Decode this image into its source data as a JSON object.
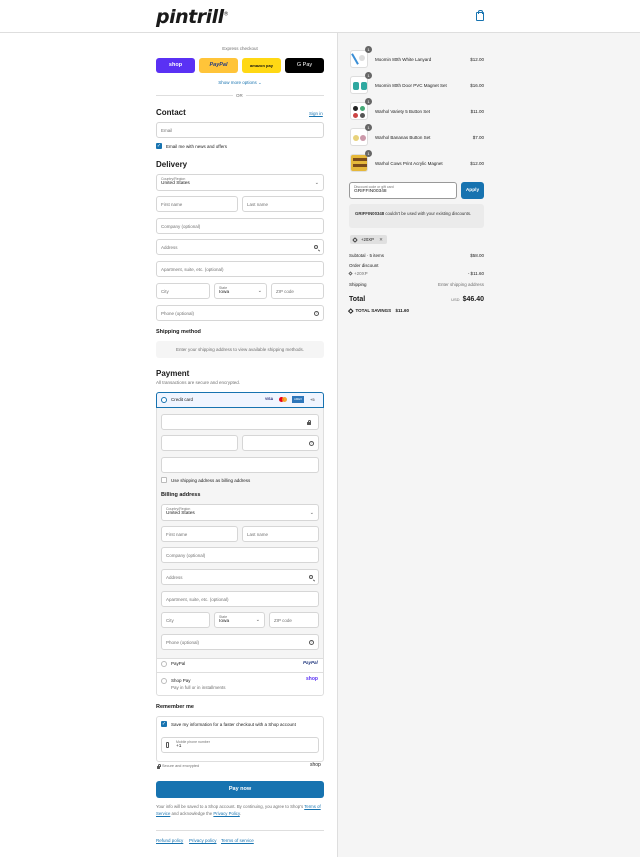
{
  "brand": {
    "logo_text": "pintrill",
    "logo_mark": "®"
  },
  "express": {
    "label": "Express checkout",
    "shop": "shop",
    "paypal": "PayPal",
    "amazon": "amazon pay",
    "gpay": "G Pay",
    "show_more": "Show more options ⌄",
    "or": "OR"
  },
  "contact": {
    "title": "Contact",
    "sign_in": "Sign in",
    "email_placeholder": "Email",
    "news_label": "Email me with news and offers"
  },
  "delivery": {
    "title": "Delivery",
    "country_label": "Country/Region",
    "country_value": "United States",
    "first_name": "First name",
    "last_name": "Last name",
    "company": "Company (optional)",
    "address": "Address",
    "apartment": "Apartment, suite, etc. (optional)",
    "city": "City",
    "state_label": "State",
    "state_value": "Iowa",
    "zip": "ZIP code",
    "phone": "Phone (optional)"
  },
  "shipping": {
    "title": "Shipping method",
    "notice": "Enter your shipping address to view available shipping methods."
  },
  "payment": {
    "title": "Payment",
    "subtitle": "All transactions are secure and encrypted.",
    "credit_card": "Credit card",
    "card_brands": [
      "VISA",
      "MC",
      "AMEX",
      "+5"
    ],
    "use_shipping": "Use shipping address as billing address",
    "billing_title": "Billing address",
    "paypal": "PayPal",
    "paypal_logo": "PayPal",
    "shop_pay": "Shop Pay",
    "shop_pay_sub": "Pay in full or in installments",
    "shop_logo": "shop"
  },
  "remember": {
    "title": "Remember me",
    "save_label": "Save my information for a faster checkout with a Shop account",
    "phone_label": "Mobile phone number",
    "phone_value": "+1",
    "secure": "Secure and encrypted",
    "shop_logo": "shop"
  },
  "pay_now": "Pay now",
  "legal": {
    "pre": "Your info will be saved to a Shop account. By continuing, you agree to Shop's",
    "tos": "Terms of Service",
    "mid": "and acknowledge the",
    "privacy": "Privacy Policy",
    "end": "."
  },
  "footer": [
    "Refund policy",
    "Privacy policy",
    "Terms of service"
  ],
  "cart": {
    "items": [
      {
        "name": "Moomin 80th White Lanyard",
        "price": "$12.00",
        "qty": "1"
      },
      {
        "name": "Moomin 80th Door PVC Magnet Set",
        "price": "$16.00",
        "qty": "1"
      },
      {
        "name": "Warhol Variety 5 Button Set",
        "price": "$11.00",
        "qty": "1"
      },
      {
        "name": "Warhol Bananas Button Set",
        "price": "$7.00",
        "qty": "1"
      },
      {
        "name": "Warhol Cows Print Acrylic Magnet",
        "price": "$12.00",
        "qty": "1"
      }
    ],
    "discount_label": "Discount code or gift card",
    "discount_value": "GRIFFIN00348",
    "apply": "Apply",
    "error_code": "GRIFFIN00348",
    "error_text": "couldn't be used with your existing discounts.",
    "tag": "+20XP",
    "subtotal_label": "Subtotal · 5 items",
    "subtotal_value": "$58.00",
    "order_discount": "Order discount",
    "discount_code": "+20XP",
    "discount_amount": "- $11.60",
    "shipping_label": "Shipping",
    "shipping_value": "Enter shipping address",
    "total_label": "Total",
    "currency": "USD",
    "total_value": "$46.40",
    "savings_label": "TOTAL SAVINGS",
    "savings_value": "$11.60"
  }
}
